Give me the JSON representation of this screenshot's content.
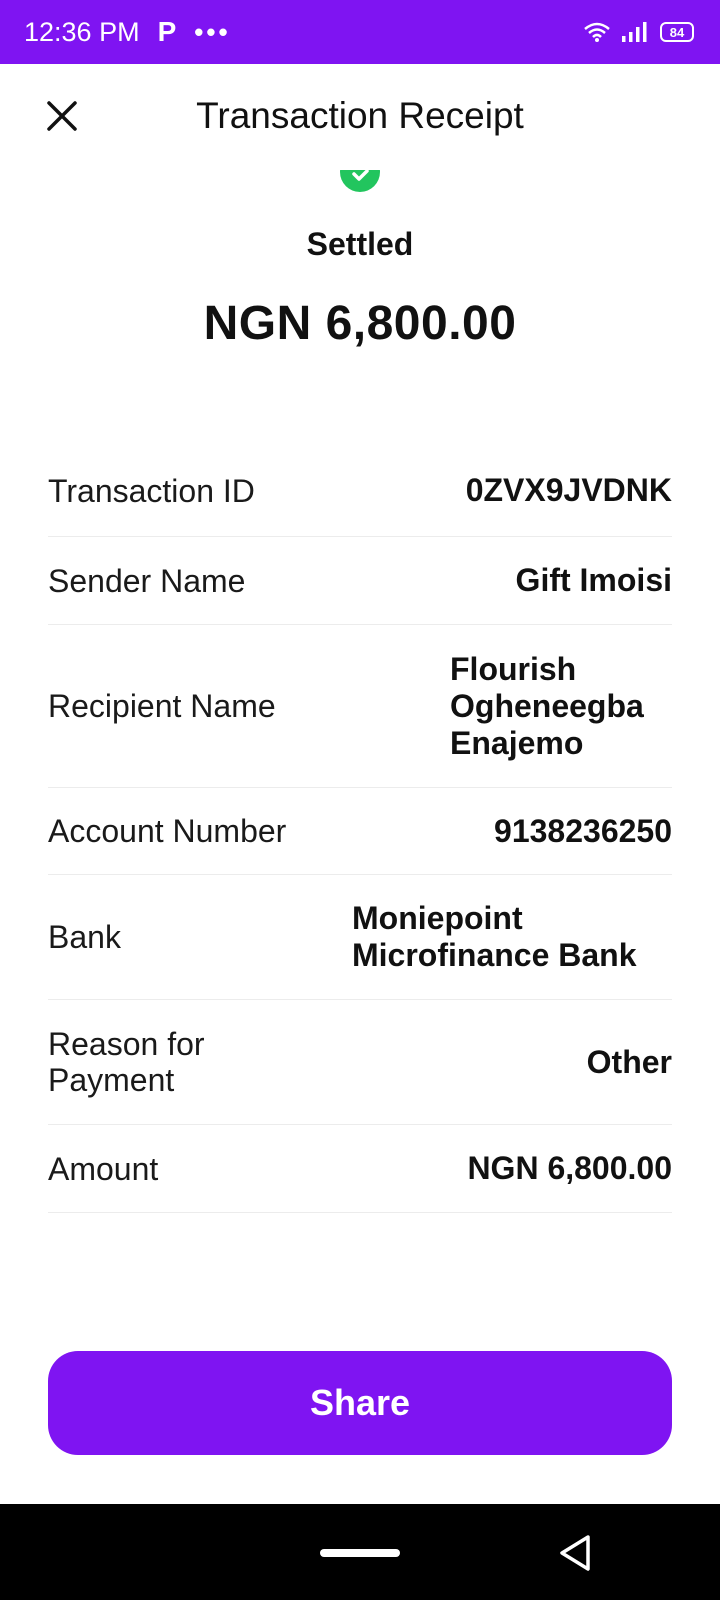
{
  "status_bar": {
    "time": "12:36 PM",
    "app_badge": "P",
    "more_dots": "•••",
    "battery_level": "84"
  },
  "header": {
    "title": "Transaction Receipt",
    "close_icon": "close-icon"
  },
  "summary": {
    "status": "Settled",
    "amount": "NGN 6,800.00",
    "status_color": "#22c55e"
  },
  "details": [
    {
      "label": "Transaction ID",
      "value": "0ZVX9JVDNK"
    },
    {
      "label": "Sender Name",
      "value": "Gift Imoisi"
    },
    {
      "label": "Recipient Name",
      "value": "Flourish Ogheneegba Enajemo"
    },
    {
      "label": "Account Number",
      "value": "9138236250"
    },
    {
      "label": "Bank",
      "value": "Moniepoint Microfinance Bank"
    },
    {
      "label": "Reason for Payment",
      "value": "Other"
    },
    {
      "label": "Amount",
      "value": "NGN 6,800.00"
    }
  ],
  "share_button": {
    "label": "Share"
  },
  "colors": {
    "brand": "#7f14f2",
    "success": "#22c55e"
  }
}
